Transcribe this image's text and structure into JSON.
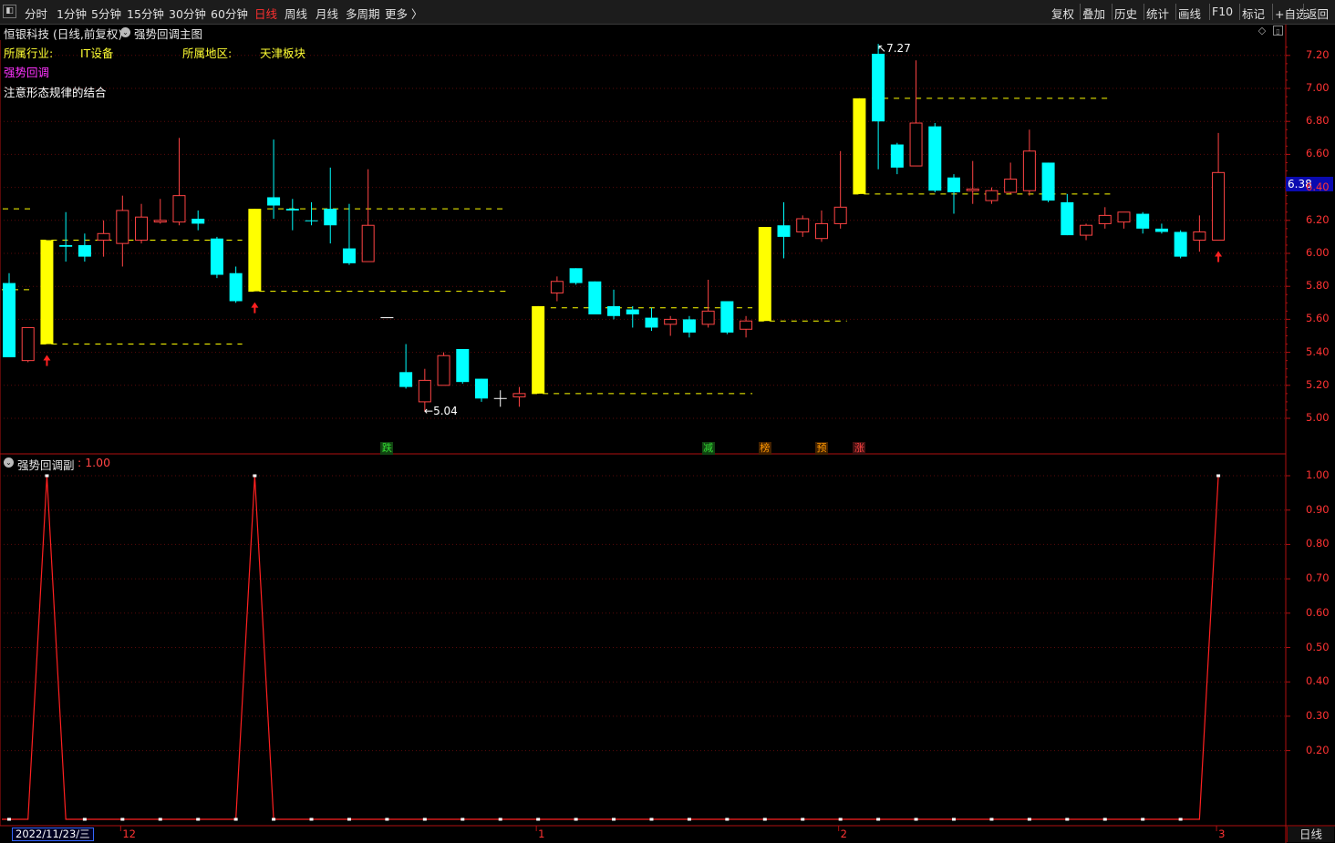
{
  "toolbar": {
    "left_items": [
      "分时",
      "1分钟",
      "5分钟",
      "15分钟",
      "30分钟",
      "60分钟",
      "日线",
      "周线",
      "月线",
      "多周期",
      "更多 〉"
    ],
    "active_item": "日线",
    "right_items": [
      "复权",
      "叠加",
      "历史",
      "统计",
      "画线",
      "F10",
      "标记",
      "+自选",
      "返回"
    ]
  },
  "main_panel": {
    "title": "恒银科技 (日线,前复权)",
    "indicator_name": "强势回调主图",
    "industry_label": "所属行业:",
    "industry_value": "IT设备",
    "region_label": "所属地区:",
    "region_value": "天津板块",
    "signal_name": "强势回调",
    "note": "注意形态规律的结合",
    "high_label": "7.27",
    "low_label": "5.04",
    "current_price": "6.38",
    "y_axis": [
      "7.20",
      "7.00",
      "6.80",
      "6.60",
      "6.40",
      "6.20",
      "6.00",
      "5.80",
      "5.60",
      "5.40",
      "5.20",
      "5.00"
    ],
    "markers": [
      {
        "text": "跌",
        "color": "#33dd33",
        "bg": "#114411"
      },
      {
        "text": "减",
        "color": "#33dd33",
        "bg": "#114411"
      },
      {
        "text": "榜",
        "color": "#ff9900",
        "bg": "#442200"
      },
      {
        "text": "预",
        "color": "#ff9900",
        "bg": "#442200"
      },
      {
        "text": "涨",
        "color": "#ff4444",
        "bg": "#441111"
      }
    ]
  },
  "sub_panel": {
    "indicator_name": "强势回调副",
    "current_value": "1.00",
    "y_axis": [
      "1.00",
      "0.90",
      "0.80",
      "0.70",
      "0.60",
      "0.50",
      "0.40",
      "0.30",
      "0.20"
    ]
  },
  "x_axis": {
    "date_box": "2022/11/23/三",
    "labels": [
      "12",
      "1",
      "2",
      "3"
    ]
  },
  "period_button": "日线",
  "colors": {
    "up": "#ff4444",
    "down": "#00ffff",
    "signal_bar": "#ffff00",
    "axis": "#b01010",
    "grid": "#5a0a0a",
    "indicator_line": "#ff2020"
  },
  "chart_data": {
    "type": "candlestick",
    "price_range": [
      4.95,
      7.3
    ],
    "candles": [
      {
        "o": 5.82,
        "h": 5.88,
        "l": 5.37,
        "c": 5.37,
        "t": "down"
      },
      {
        "o": 5.35,
        "h": 5.55,
        "l": 5.34,
        "c": 5.55,
        "t": "up"
      },
      {
        "o": 5.45,
        "h": 6.08,
        "l": 5.45,
        "c": 6.08,
        "t": "signal"
      },
      {
        "o": 6.05,
        "h": 6.25,
        "l": 5.95,
        "c": 6.04,
        "t": "down"
      },
      {
        "o": 6.05,
        "h": 6.12,
        "l": 5.95,
        "c": 5.98,
        "t": "down"
      },
      {
        "o": 6.08,
        "h": 6.2,
        "l": 5.98,
        "c": 6.12,
        "t": "up"
      },
      {
        "o": 6.06,
        "h": 6.35,
        "l": 5.92,
        "c": 6.26,
        "t": "up"
      },
      {
        "o": 6.08,
        "h": 6.3,
        "l": 6.06,
        "c": 6.22,
        "t": "up"
      },
      {
        "o": 6.19,
        "h": 6.33,
        "l": 6.18,
        "c": 6.2,
        "t": "up"
      },
      {
        "o": 6.19,
        "h": 6.7,
        "l": 6.17,
        "c": 6.35,
        "t": "up"
      },
      {
        "o": 6.21,
        "h": 6.26,
        "l": 6.14,
        "c": 6.18,
        "t": "down"
      },
      {
        "o": 6.09,
        "h": 6.1,
        "l": 5.85,
        "c": 5.87,
        "t": "down"
      },
      {
        "o": 5.88,
        "h": 5.92,
        "l": 5.7,
        "c": 5.71,
        "t": "down"
      },
      {
        "o": 5.77,
        "h": 6.27,
        "l": 5.77,
        "c": 6.27,
        "t": "signal"
      },
      {
        "o": 6.34,
        "h": 6.69,
        "l": 6.21,
        "c": 6.29,
        "t": "down"
      },
      {
        "o": 6.27,
        "h": 6.33,
        "l": 6.14,
        "c": 6.26,
        "t": "down"
      },
      {
        "o": 6.2,
        "h": 6.31,
        "l": 6.17,
        "c": 6.2,
        "t": "down"
      },
      {
        "o": 6.27,
        "h": 6.52,
        "l": 6.06,
        "c": 6.17,
        "t": "down"
      },
      {
        "o": 6.03,
        "h": 6.3,
        "l": 5.93,
        "c": 5.94,
        "t": "down"
      },
      {
        "o": 5.95,
        "h": 6.51,
        "l": 5.95,
        "c": 6.17,
        "t": "up"
      },
      {
        "o": 5.61,
        "h": 5.61,
        "l": 5.61,
        "c": 5.61,
        "t": "flat"
      },
      {
        "o": 5.28,
        "h": 5.45,
        "l": 5.18,
        "c": 5.19,
        "t": "down"
      },
      {
        "o": 5.1,
        "h": 5.3,
        "l": 5.04,
        "c": 5.23,
        "t": "up"
      },
      {
        "o": 5.2,
        "h": 5.4,
        "l": 5.2,
        "c": 5.38,
        "t": "up"
      },
      {
        "o": 5.42,
        "h": 5.42,
        "l": 5.21,
        "c": 5.22,
        "t": "down"
      },
      {
        "o": 5.24,
        "h": 5.24,
        "l": 5.1,
        "c": 5.12,
        "t": "down"
      },
      {
        "o": 5.12,
        "h": 5.17,
        "l": 5.07,
        "c": 5.12,
        "t": "flat"
      },
      {
        "o": 5.13,
        "h": 5.19,
        "l": 5.07,
        "c": 5.15,
        "t": "up"
      },
      {
        "o": 5.15,
        "h": 5.68,
        "l": 5.15,
        "c": 5.68,
        "t": "signal"
      },
      {
        "o": 5.76,
        "h": 5.86,
        "l": 5.71,
        "c": 5.83,
        "t": "up"
      },
      {
        "o": 5.91,
        "h": 5.91,
        "l": 5.81,
        "c": 5.82,
        "t": "down"
      },
      {
        "o": 5.83,
        "h": 5.83,
        "l": 5.64,
        "c": 5.63,
        "t": "down"
      },
      {
        "o": 5.68,
        "h": 5.78,
        "l": 5.6,
        "c": 5.62,
        "t": "down"
      },
      {
        "o": 5.66,
        "h": 5.68,
        "l": 5.55,
        "c": 5.63,
        "t": "down"
      },
      {
        "o": 5.61,
        "h": 5.67,
        "l": 5.53,
        "c": 5.55,
        "t": "down"
      },
      {
        "o": 5.57,
        "h": 5.62,
        "l": 5.5,
        "c": 5.6,
        "t": "up"
      },
      {
        "o": 5.6,
        "h": 5.62,
        "l": 5.49,
        "c": 5.52,
        "t": "down"
      },
      {
        "o": 5.57,
        "h": 5.84,
        "l": 5.55,
        "c": 5.65,
        "t": "up"
      },
      {
        "o": 5.71,
        "h": 5.71,
        "l": 5.51,
        "c": 5.52,
        "t": "down"
      },
      {
        "o": 5.54,
        "h": 5.62,
        "l": 5.49,
        "c": 5.59,
        "t": "up"
      },
      {
        "o": 5.59,
        "h": 6.16,
        "l": 5.59,
        "c": 6.16,
        "t": "signal"
      },
      {
        "o": 6.17,
        "h": 6.31,
        "l": 5.97,
        "c": 6.1,
        "t": "down"
      },
      {
        "o": 6.13,
        "h": 6.23,
        "l": 6.1,
        "c": 6.21,
        "t": "up"
      },
      {
        "o": 6.09,
        "h": 6.26,
        "l": 6.07,
        "c": 6.18,
        "t": "up"
      },
      {
        "o": 6.18,
        "h": 6.62,
        "l": 6.15,
        "c": 6.28,
        "t": "up"
      },
      {
        "o": 6.36,
        "h": 6.94,
        "l": 6.36,
        "c": 6.94,
        "t": "signal"
      },
      {
        "o": 6.8,
        "h": 7.27,
        "l": 6.51,
        "c": 7.21,
        "t": "down"
      },
      {
        "o": 6.66,
        "h": 6.67,
        "l": 6.48,
        "c": 6.52,
        "t": "down"
      },
      {
        "o": 6.53,
        "h": 7.17,
        "l": 6.53,
        "c": 6.79,
        "t": "up"
      },
      {
        "o": 6.77,
        "h": 6.79,
        "l": 6.37,
        "c": 6.38,
        "t": "down"
      },
      {
        "o": 6.46,
        "h": 6.48,
        "l": 6.24,
        "c": 6.37,
        "t": "down"
      },
      {
        "o": 6.38,
        "h": 6.56,
        "l": 6.3,
        "c": 6.39,
        "t": "up"
      },
      {
        "o": 6.32,
        "h": 6.4,
        "l": 6.3,
        "c": 6.38,
        "t": "up"
      },
      {
        "o": 6.37,
        "h": 6.55,
        "l": 6.36,
        "c": 6.45,
        "t": "up"
      },
      {
        "o": 6.38,
        "h": 6.75,
        "l": 6.35,
        "c": 6.62,
        "t": "up"
      },
      {
        "o": 6.55,
        "h": 6.55,
        "l": 6.31,
        "c": 6.32,
        "t": "down"
      },
      {
        "o": 6.31,
        "h": 6.36,
        "l": 6.11,
        "c": 6.11,
        "t": "down"
      },
      {
        "o": 6.11,
        "h": 6.18,
        "l": 6.08,
        "c": 6.17,
        "t": "up"
      },
      {
        "o": 6.18,
        "h": 6.28,
        "l": 6.15,
        "c": 6.23,
        "t": "up"
      },
      {
        "o": 6.19,
        "h": 6.25,
        "l": 6.15,
        "c": 6.25,
        "t": "up"
      },
      {
        "o": 6.24,
        "h": 6.25,
        "l": 6.12,
        "c": 6.15,
        "t": "down"
      },
      {
        "o": 6.15,
        "h": 6.18,
        "l": 6.12,
        "c": 6.13,
        "t": "down"
      },
      {
        "o": 6.13,
        "h": 6.14,
        "l": 5.97,
        "c": 5.98,
        "t": "down"
      },
      {
        "o": 6.08,
        "h": 6.23,
        "l": 6.01,
        "c": 6.13,
        "t": "up"
      },
      {
        "o": 6.08,
        "h": 6.73,
        "l": 6.08,
        "c": 6.49,
        "t": "up"
      }
    ],
    "support_lines": [
      {
        "price": 6.27,
        "from": 0,
        "to": 1
      },
      {
        "price": 5.45,
        "from": 2,
        "to": 12
      },
      {
        "price": 5.77,
        "from": 13,
        "to": 26
      },
      {
        "price": 6.27,
        "from": 14,
        "to": 26
      },
      {
        "price": 6.08,
        "from": 2,
        "to": 12
      },
      {
        "price": 5.78,
        "from": -1,
        "to": 1
      },
      {
        "price": 5.15,
        "from": 28,
        "to": 39
      },
      {
        "price": 5.67,
        "from": 29,
        "to": 39
      },
      {
        "price": 5.59,
        "from": 40,
        "to": 44
      },
      {
        "price": 6.36,
        "from": 45,
        "to": 58
      },
      {
        "price": 6.94,
        "from": 46,
        "to": 58
      }
    ],
    "buy_arrows": [
      2,
      13,
      64
    ],
    "sub_indicator": [
      0,
      0,
      1,
      0,
      0,
      0,
      0,
      0,
      0,
      0,
      0,
      0,
      0,
      1,
      0,
      0,
      0,
      0,
      0,
      0,
      0,
      0,
      0,
      0,
      0,
      0,
      0,
      0,
      0,
      0,
      0,
      0,
      0,
      0,
      0,
      0,
      0,
      0,
      0,
      0,
      0,
      0,
      0,
      0,
      0,
      0,
      0,
      0,
      0,
      0,
      0,
      0,
      0,
      0,
      0,
      0,
      0,
      0,
      0,
      0,
      0,
      0,
      0,
      0,
      1
    ]
  }
}
